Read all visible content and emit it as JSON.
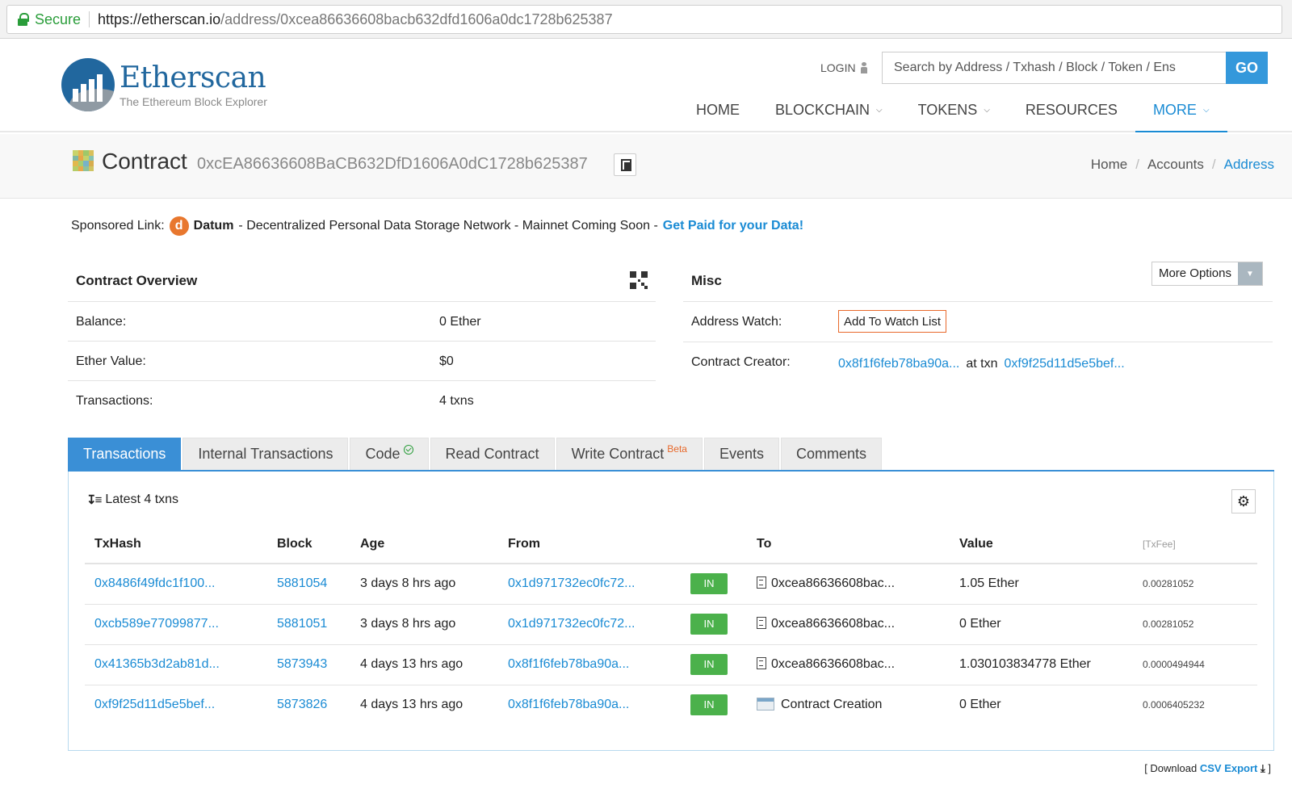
{
  "browser": {
    "secure_label": "Secure",
    "url_host": "https://etherscan.io",
    "url_path": "/address/0xcea86636608bacb632dfd1606a0dc1728b625387"
  },
  "header": {
    "logo_title": "Etherscan",
    "logo_subtitle": "The Ethereum Block Explorer",
    "login_label": "LOGIN",
    "search_placeholder": "Search by Address / Txhash / Block / Token / Ens",
    "go_label": "GO",
    "nav": [
      {
        "label": "HOME",
        "dropdown": false
      },
      {
        "label": "BLOCKCHAIN",
        "dropdown": true
      },
      {
        "label": "TOKENS",
        "dropdown": true
      },
      {
        "label": "RESOURCES",
        "dropdown": false
      },
      {
        "label": "MORE",
        "dropdown": true,
        "active": true
      }
    ]
  },
  "titlebar": {
    "label": "Contract",
    "address": "0xcEA86636608BaCB632DfD1606A0dC1728b625387",
    "breadcrumb": [
      "Home",
      "Accounts",
      "Address"
    ]
  },
  "sponsored": {
    "prefix": "Sponsored Link:",
    "brand": "Datum",
    "text": "- Decentralized Personal Data Storage Network - Mainnet Coming Soon -",
    "cta": "Get Paid for your Data!"
  },
  "overview": {
    "title": "Contract Overview",
    "rows": [
      {
        "key": "Balance:",
        "value": "0 Ether"
      },
      {
        "key": "Ether Value:",
        "value": "$0"
      },
      {
        "key": "Transactions:",
        "value": "4 txns"
      }
    ]
  },
  "misc": {
    "title": "Misc",
    "more_options": "More Options",
    "watch_key": "Address Watch:",
    "watch_button": "Add To Watch List",
    "creator_key": "Contract Creator:",
    "creator_address": "0x8f1f6feb78ba90a...",
    "at_txn": "at txn",
    "creator_txn": "0xf9f25d11d5e5bef..."
  },
  "tabs": [
    {
      "label": "Transactions",
      "active": true
    },
    {
      "label": "Internal Transactions"
    },
    {
      "label": "Code",
      "verified": true
    },
    {
      "label": "Read Contract"
    },
    {
      "label": "Write Contract",
      "beta": "Beta"
    },
    {
      "label": "Events"
    },
    {
      "label": "Comments"
    }
  ],
  "transactions": {
    "summary": "Latest 4 txns",
    "columns": [
      "TxHash",
      "Block",
      "Age",
      "From",
      "",
      "To",
      "Value",
      "[TxFee]"
    ],
    "rows": [
      {
        "hash": "0x8486f49fdc1f100...",
        "block": "5881054",
        "age": "3 days 8 hrs ago",
        "from": "0x1d971732ec0fc72...",
        "dir": "IN",
        "to": "0xcea86636608bac...",
        "to_type": "contract",
        "value": "1.05 Ether",
        "fee": "0.00281052"
      },
      {
        "hash": "0xcb589e77099877...",
        "block": "5881051",
        "age": "3 days 8 hrs ago",
        "from": "0x1d971732ec0fc72...",
        "dir": "IN",
        "to": "0xcea86636608bac...",
        "to_type": "contract",
        "value": "0 Ether",
        "fee": "0.00281052"
      },
      {
        "hash": "0x41365b3d2ab81d...",
        "block": "5873943",
        "age": "4 days 13 hrs ago",
        "from": "0x8f1f6feb78ba90a...",
        "dir": "IN",
        "to": "0xcea86636608bac...",
        "to_type": "contract",
        "value": "1.030103834778 Ether",
        "fee": "0.0000494944"
      },
      {
        "hash": "0xf9f25d11d5e5bef...",
        "block": "5873826",
        "age": "4 days 13 hrs ago",
        "from": "0x8f1f6feb78ba90a...",
        "dir": "IN",
        "to": "Contract Creation",
        "to_type": "creation",
        "value": "0 Ether",
        "fee": "0.0006405232"
      }
    ]
  },
  "csv": {
    "prefix": "[ Download",
    "link": "CSV Export",
    "suffix": "]"
  },
  "colors": {
    "accent": "#3a8fd6",
    "link": "#1a8bd4",
    "in_badge": "#4bb14b",
    "secure": "#2a9d3a",
    "watch_border": "#e8692b"
  }
}
